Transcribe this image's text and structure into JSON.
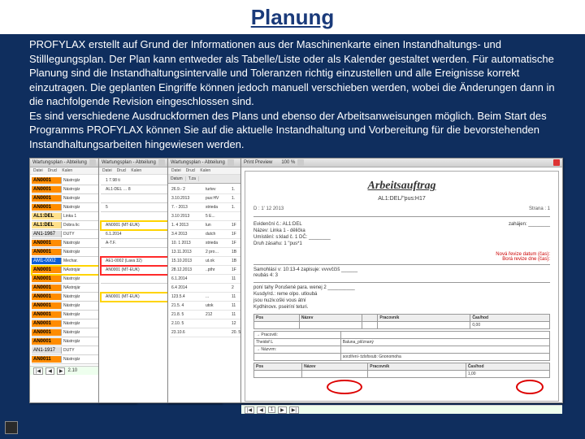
{
  "title": "Planung",
  "paragraph": "PROFYLAX erstellt auf Grund der Informationen aus der Maschinenkarte einen Instandhaltungs- und Stilllegungsplan. Der Plan kann entweder als Tabelle/Liste oder als Kalender gestaltet werden. Für automatische Planung sind die Instandhaltungsintervalle und Toleranzen richtig einzustellen und alle Ereignisse korrekt einzutragen. Die geplanten Eingriffe können jedoch manuell verschieben werden, wobei die Änderungen dann in die nachfolgende Revision eingeschlossen sind.\nEs sind verschiedene Ausdruckformen des Plans und ebenso der Arbeitsanweisungen möglich. Beim Start des Programms PROFYLAX können Sie auf die aktuelle Instandhaltung und Vorbereitung für die bevorstehenden Instandhaltungsarbeiten hingewiesen werden.",
  "panel_title": "Wartungsplan - Abteilung",
  "menu": [
    "Datei",
    "Drucl",
    "Kalen"
  ],
  "grid1_rows": [
    {
      "id": "AN0001",
      "cls": "id",
      "txt": "Nástrojár"
    },
    {
      "id": "AN0001",
      "cls": "id",
      "txt": "Nástrojár"
    },
    {
      "id": "AN0001",
      "cls": "id",
      "txt": "Nástrojár"
    },
    {
      "id": "AN0001",
      "cls": "id",
      "txt": "Nástrojár"
    },
    {
      "id": "AL1:DEL",
      "cls": "id2",
      "txt": "Linka 1"
    },
    {
      "id": "AL1:DEL",
      "cls": "id2",
      "txt": "Dobra lic"
    },
    {
      "id": "AN1-1967",
      "cls": "idg",
      "txt": "DUTY"
    },
    {
      "id": "AN0001",
      "cls": "id",
      "txt": "Nástrojár"
    },
    {
      "id": "AN0001",
      "cls": "id",
      "txt": "Nástrojár"
    },
    {
      "id": "AM1-0002",
      "cls": "idb",
      "txt": "Mechar."
    },
    {
      "id": "AN0001",
      "cls": "id",
      "txt": "NAstrojár",
      "sel": true
    },
    {
      "id": "AN0001",
      "cls": "id",
      "txt": "Nástrojár"
    },
    {
      "id": "AN0001",
      "cls": "id",
      "txt": "NAstrojár"
    },
    {
      "id": "AN0001",
      "cls": "id",
      "txt": "Nástrojár"
    },
    {
      "id": "AN0001",
      "cls": "id",
      "txt": "Nástrojár"
    },
    {
      "id": "AN0001",
      "cls": "id",
      "txt": "Nástrojár"
    },
    {
      "id": "AN0001",
      "cls": "id",
      "txt": "Nástrojár"
    },
    {
      "id": "AN0001",
      "cls": "id",
      "txt": "Nástrojár"
    },
    {
      "id": "AN0001",
      "cls": "id",
      "txt": "Nástrojár"
    },
    {
      "id": "AN1-1917",
      "cls": "idg",
      "txt": "DUTY"
    },
    {
      "id": "AN0011",
      "cls": "id",
      "txt": "Nástrojár"
    }
  ],
  "grid2_rows": [
    {
      "id": "",
      "txt": "1 7.98 ti"
    },
    {
      "id": "",
      "txt": "AL1-DEL … 8"
    },
    {
      "id": "",
      "txt": ""
    },
    {
      "id": "",
      "txt": "5"
    },
    {
      "id": "",
      "txt": ""
    },
    {
      "id": "",
      "txt": "AN0001 (MT-EUK)",
      "sel": true
    },
    {
      "id": "",
      "txt": "6.1.2014"
    },
    {
      "id": "",
      "txt": "A-T.F."
    },
    {
      "id": "",
      "txt": ""
    },
    {
      "id": "",
      "txt": "AE1-0002 (Lava 32)",
      "selR": true
    },
    {
      "id": "",
      "txt": "AN0001 (MT-EUK)",
      "selR": true
    },
    {
      "id": "",
      "txt": ""
    },
    {
      "id": "",
      "txt": ""
    },
    {
      "id": "",
      "txt": "AN0001 (MT-EUK)",
      "sel": true
    }
  ],
  "dates_header": [
    "Datum",
    "T.za",
    "",
    ""
  ],
  "dates": [
    {
      "d": "26.9.- 2",
      "a": "turtev",
      "b": "1."
    },
    {
      "d": "3.10.2013",
      "a": "pus:HV",
      "b": "1."
    },
    {
      "d": "7. - 2013",
      "a": "strieda",
      "b": "1."
    },
    {
      "d": "3.10 2013",
      "a": "5 E...",
      "b": ""
    },
    {
      "d": "1. 4 2013",
      "a": "lun",
      "b": "1F"
    },
    {
      "d": "3.4 2013",
      "a": "dutch",
      "b": "1F"
    },
    {
      "d": "10. 1 2013",
      "a": "strieda",
      "b": "1F"
    },
    {
      "d": "13.11.2013",
      "a": "2 pro…",
      "b": "1B"
    },
    {
      "d": "15.10.2013",
      "a": "ut.ok",
      "b": "1B"
    },
    {
      "d": "28.12.2013",
      "a": "..pthr",
      "b": "1F"
    },
    {
      "d": "6.1.2014",
      "a": "",
      "b": "11"
    },
    {
      "d": "6.4 2014",
      "a": "",
      "b": "2"
    },
    {
      "d": "123.5.4",
      "a": "...",
      "b": "11"
    },
    {
      "d": "21.5. 4",
      "a": "utok",
      "b": "11"
    },
    {
      "d": "21.8. 5",
      "a": "212 ",
      "b": "11"
    },
    {
      "d": "2.10. 5",
      "a": "",
      "b": "12"
    },
    {
      "d": "23.10.6",
      "a": "",
      "b": "20. 5"
    }
  ],
  "preview": {
    "title": "Print Preview",
    "zoom": "100 %",
    "report_title": "Arbeitsauftrag",
    "report_sub": "AL1:DEL/\"pus:H17",
    "meta_left": "D : 1' 12 2013",
    "meta_right": "Strana : 1",
    "block1_lines": [
      "Evidenční č.: AL1:DEL",
      "Název:  Linka 1 - dělička",
      "Umístění: s:klad č. 1          DČ: ________",
      "Druh zásahu:  1 \"pus*1"
    ],
    "block1_right": "zahájen: ________",
    "redline": "Nová řevize datum (čas):\nBorá revize dne (čas):",
    "block2_lines": [
      "Samohlásí v:   10:13-4     zapisuje: vvvvččíš ______",
      "reubás 4:       3"
    ],
    "block3_lines": [
      "poní tahy   Porušené para. wenej     2 __________",
      "Kusdy/rd.:  reme olpo. utloubá",
      "                jsou nuziv.oški vous átní",
      "Kydhinovx. pseiríní teturi."
    ],
    "table1_header": [
      "Pos",
      "Název",
      "",
      "Pracovník",
      "Čas/hod"
    ],
    "table1_row": [
      "",
      "",
      "",
      "",
      "0,00"
    ],
    "table2_rows": [
      [
        "→ Pracoviš:",
        ""
      ],
      [
        "  Theidoř:L",
        "Baluna_pil/znaný"
      ],
      [
        "→ Názvrm:",
        ""
      ],
      [
        "",
        "sorzlření-:tzlsfxxub: Gnonomoha"
      ]
    ],
    "table3_header": [
      "Pos",
      "Název",
      "Pracovník",
      "Čas/hod"
    ],
    "table3_row": [
      "",
      "",
      "",
      "1,00"
    ],
    "pager": "1"
  },
  "date_footer": "2.10"
}
